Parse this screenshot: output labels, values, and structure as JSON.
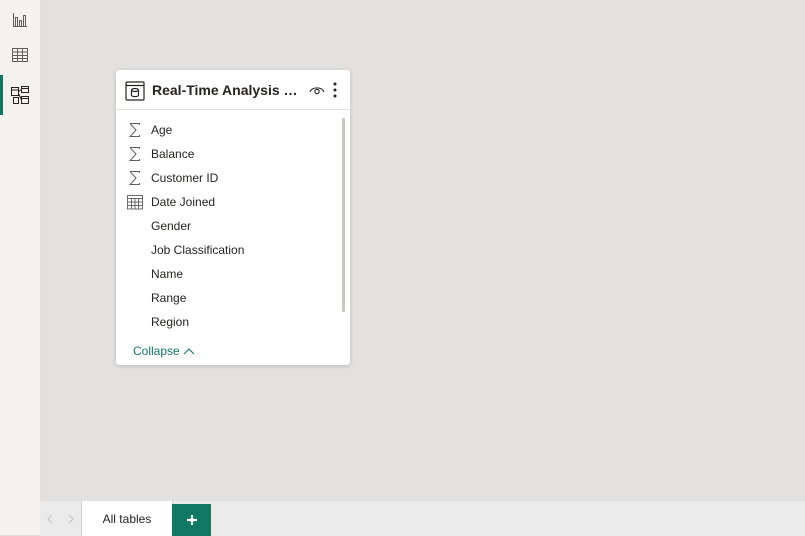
{
  "rail": {
    "items": [
      {
        "name": "report-view",
        "icon": "bar-chart-icon"
      },
      {
        "name": "table-view",
        "icon": "table-grid-icon"
      },
      {
        "name": "model-view",
        "icon": "model-icon",
        "active": true
      }
    ]
  },
  "card": {
    "title": "Real-Time Analysis of...",
    "fields": [
      {
        "label": "Age",
        "icon": "sigma-icon"
      },
      {
        "label": "Balance",
        "icon": "sigma-icon"
      },
      {
        "label": "Customer ID",
        "icon": "sigma-icon"
      },
      {
        "label": "Date Joined",
        "icon": "calendar-icon"
      },
      {
        "label": "Gender",
        "icon": ""
      },
      {
        "label": "Job Classification",
        "icon": ""
      },
      {
        "label": "Name",
        "icon": ""
      },
      {
        "label": "Range",
        "icon": ""
      },
      {
        "label": "Region",
        "icon": ""
      }
    ],
    "collapse_label": "Collapse"
  },
  "tabs": {
    "items": [
      {
        "label": "All tables"
      }
    ],
    "add_label": "+"
  },
  "colors": {
    "accent": "#117865",
    "canvas": "#e2e1df"
  }
}
